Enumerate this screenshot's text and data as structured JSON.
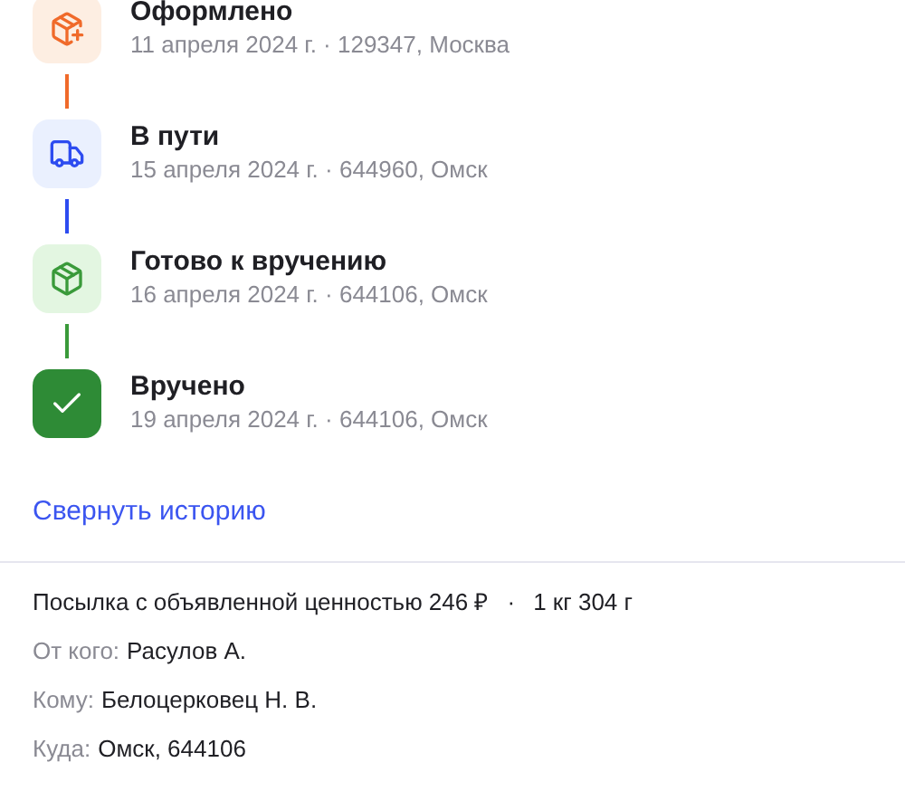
{
  "history": [
    {
      "kind": "created",
      "title": "Оформлено",
      "subtitle": "11 апреля 2024 г. · 129347, Москва"
    },
    {
      "kind": "transit",
      "title": "В пути",
      "subtitle": "15 апреля 2024 г. · 644960, Омск"
    },
    {
      "kind": "ready",
      "title": "Готово к вручению",
      "subtitle": "16 апреля 2024 г. · 644106, Омск"
    },
    {
      "kind": "delivered",
      "title": "Вручено",
      "subtitle": "19 апреля 2024 г. · 644106, Омск"
    }
  ],
  "collapse_link": "Свернуть историю",
  "parcel": {
    "description": "Посылка с объявленной ценностью 246 ₽",
    "separator": "·",
    "weight": "1 кг 304 г"
  },
  "details": [
    {
      "label": "От кого:",
      "value": "Расулов А."
    },
    {
      "label": "Кому:",
      "value": "Белоцерковец Н. В."
    },
    {
      "label": "Куда:",
      "value": "Омск, 644106"
    }
  ]
}
